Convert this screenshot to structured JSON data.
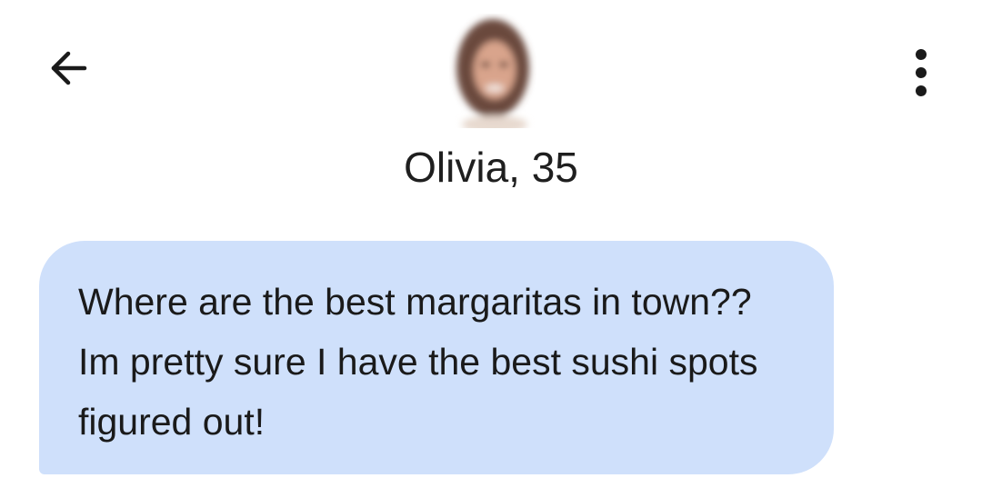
{
  "header": {
    "back_icon": "arrow-left-icon",
    "more_icon": "more-vertical-icon",
    "profile": {
      "name_age": "Olivia, 35",
      "avatar": "blurred-profile-photo"
    }
  },
  "messages": [
    {
      "direction": "incoming",
      "text": "Where are the best margaritas in town?? Im pretty sure I have the best sushi spots figured out!"
    }
  ],
  "colors": {
    "incoming_bubble": "#cfe0fb",
    "text": "#1a1a1a",
    "background": "#ffffff"
  }
}
